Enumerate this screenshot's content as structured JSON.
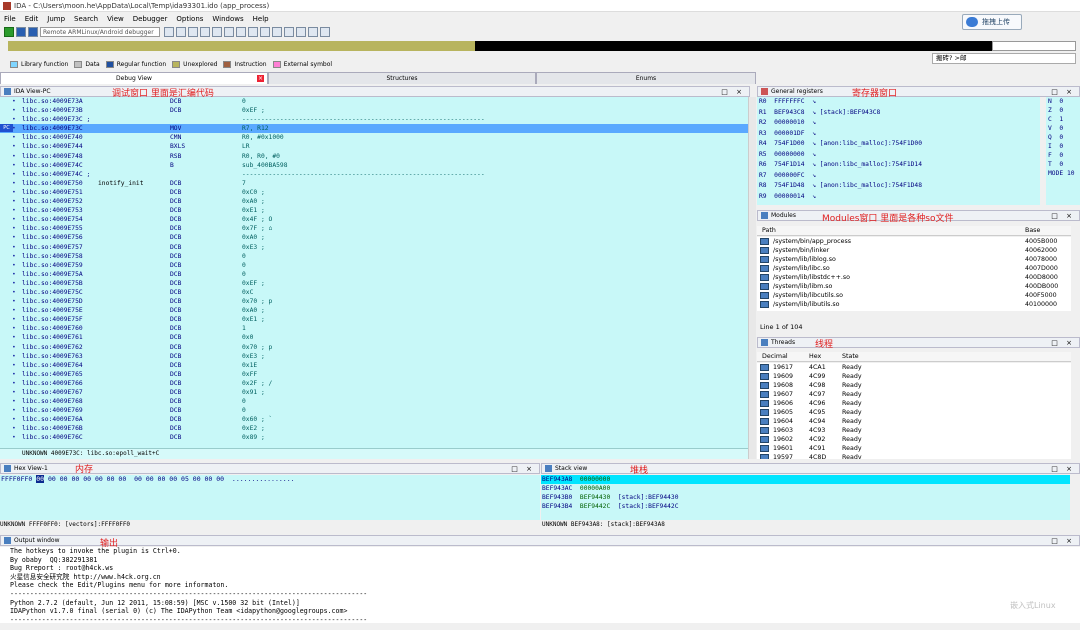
{
  "window": {
    "title": "IDA - C:\\Users\\moon.he\\AppData\\Local\\Temp\\ida93301.ido (app_process)"
  },
  "upload_button": "拖拽上传",
  "menu": [
    "File",
    "Edit",
    "Jump",
    "Search",
    "View",
    "Debugger",
    "Options",
    "Windows",
    "Help"
  ],
  "debugger_select": "Remote ARMLinux/Android debugger",
  "legend": [
    {
      "label": "Library function",
      "color": "#7fd5ff"
    },
    {
      "label": "Data",
      "color": "#c0c0c0"
    },
    {
      "label": "Regular function",
      "color": "#2050a0"
    },
    {
      "label": "Unexplored",
      "color": "#b8b45e"
    },
    {
      "label": "Instruction",
      "color": "#a06040"
    },
    {
      "label": "External symbol",
      "color": "#ff7fd5"
    }
  ],
  "tip": "搬砖? >邮",
  "tabs": {
    "debug": "Debug View",
    "structures": "Structures",
    "enums": "Enums"
  },
  "ida_view": {
    "title": "IDA View-PC",
    "annotation": "调试窗口 里面是汇编代码"
  },
  "pc_marker": "PC",
  "disasm": [
    {
      "addr": "libc.so:4009E73A",
      "lbl": "",
      "mn": "DCB",
      "op": "0",
      "sel": false
    },
    {
      "addr": "libc.so:4009E73B",
      "lbl": "",
      "mn": "DCB",
      "op": "0xEF ;",
      "sel": false
    },
    {
      "addr": "libc.so:4009E73C ;",
      "lbl": "",
      "mn": "",
      "op": "----------------------------------------------------------------",
      "sel": false
    },
    {
      "addr": "libc.so:4009E73C",
      "lbl": "",
      "mn": "MOV",
      "op": "R7, R12",
      "sel": true
    },
    {
      "addr": "libc.so:4009E740",
      "lbl": "",
      "mn": "CMN",
      "op": "R0, #0x1000",
      "sel": false
    },
    {
      "addr": "libc.so:4009E744",
      "lbl": "",
      "mn": "BXLS",
      "op": "LR",
      "sel": false
    },
    {
      "addr": "libc.so:4009E748",
      "lbl": "",
      "mn": "RSB",
      "op": "R0, R0, #0",
      "sel": false
    },
    {
      "addr": "libc.so:4009E74C",
      "lbl": "",
      "mn": "B",
      "op": "sub_400BA598",
      "sel": false
    },
    {
      "addr": "libc.so:4009E74C ;",
      "lbl": "",
      "mn": "",
      "op": "----------------------------------------------------------------",
      "sel": false
    },
    {
      "addr": "libc.so:4009E750",
      "lbl": "inotify_init",
      "mn": "DCB",
      "op": "7",
      "sel": false
    },
    {
      "addr": "libc.so:4009E751",
      "lbl": "",
      "mn": "DCB",
      "op": "0xC0 ;",
      "sel": false
    },
    {
      "addr": "libc.so:4009E752",
      "lbl": "",
      "mn": "DCB",
      "op": "0xA0 ;",
      "sel": false
    },
    {
      "addr": "libc.so:4009E753",
      "lbl": "",
      "mn": "DCB",
      "op": "0xE1 ;",
      "sel": false
    },
    {
      "addr": "libc.so:4009E754",
      "lbl": "",
      "mn": "DCB",
      "op": "0x4F ; O",
      "sel": false
    },
    {
      "addr": "libc.so:4009E755",
      "lbl": "",
      "mn": "DCB",
      "op": "0x7F ; ⌂",
      "sel": false
    },
    {
      "addr": "libc.so:4009E756",
      "lbl": "",
      "mn": "DCB",
      "op": "0xA0 ;",
      "sel": false
    },
    {
      "addr": "libc.so:4009E757",
      "lbl": "",
      "mn": "DCB",
      "op": "0xE3 ;",
      "sel": false
    },
    {
      "addr": "libc.so:4009E758",
      "lbl": "",
      "mn": "DCB",
      "op": "0",
      "sel": false
    },
    {
      "addr": "libc.so:4009E759",
      "lbl": "",
      "mn": "DCB",
      "op": "0",
      "sel": false
    },
    {
      "addr": "libc.so:4009E75A",
      "lbl": "",
      "mn": "DCB",
      "op": "0",
      "sel": false
    },
    {
      "addr": "libc.so:4009E75B",
      "lbl": "",
      "mn": "DCB",
      "op": "0xEF ;",
      "sel": false
    },
    {
      "addr": "libc.so:4009E75C",
      "lbl": "",
      "mn": "DCB",
      "op": "0xC",
      "sel": false
    },
    {
      "addr": "libc.so:4009E75D",
      "lbl": "",
      "mn": "DCB",
      "op": "0x70 ; p",
      "sel": false
    },
    {
      "addr": "libc.so:4009E75E",
      "lbl": "",
      "mn": "DCB",
      "op": "0xA0 ;",
      "sel": false
    },
    {
      "addr": "libc.so:4009E75F",
      "lbl": "",
      "mn": "DCB",
      "op": "0xE1 ;",
      "sel": false
    },
    {
      "addr": "libc.so:4009E760",
      "lbl": "",
      "mn": "DCB",
      "op": "1",
      "sel": false
    },
    {
      "addr": "libc.so:4009E761",
      "lbl": "",
      "mn": "DCB",
      "op": "0x0",
      "sel": false
    },
    {
      "addr": "libc.so:4009E762",
      "lbl": "",
      "mn": "DCB",
      "op": "0x70 ; p",
      "sel": false
    },
    {
      "addr": "libc.so:4009E763",
      "lbl": "",
      "mn": "DCB",
      "op": "0xE3 ;",
      "sel": false
    },
    {
      "addr": "libc.so:4009E764",
      "lbl": "",
      "mn": "DCB",
      "op": "0x1E",
      "sel": false
    },
    {
      "addr": "libc.so:4009E765",
      "lbl": "",
      "mn": "DCB",
      "op": "0xFF",
      "sel": false
    },
    {
      "addr": "libc.so:4009E766",
      "lbl": "",
      "mn": "DCB",
      "op": "0x2F ; /",
      "sel": false
    },
    {
      "addr": "libc.so:4009E767",
      "lbl": "",
      "mn": "DCB",
      "op": "0x91 ;",
      "sel": false
    },
    {
      "addr": "libc.so:4009E768",
      "lbl": "",
      "mn": "DCB",
      "op": "0",
      "sel": false
    },
    {
      "addr": "libc.so:4009E769",
      "lbl": "",
      "mn": "DCB",
      "op": "0",
      "sel": false
    },
    {
      "addr": "libc.so:4009E76A",
      "lbl": "",
      "mn": "DCB",
      "op": "0x60 ; `",
      "sel": false
    },
    {
      "addr": "libc.so:4009E76B",
      "lbl": "",
      "mn": "DCB",
      "op": "0xE2 ;",
      "sel": false
    },
    {
      "addr": "libc.so:4009E76C",
      "lbl": "",
      "mn": "DCB",
      "op": "0x89 ;",
      "sel": false
    }
  ],
  "disasm_status": "UNKNOWN 4009E73C: libc.so:epoll_wait+C",
  "registers": {
    "title": "General registers",
    "annotation": "寄存器窗口",
    "rows": [
      "R0  FFFFFFFC  ↘",
      "R1  BEF943C8  ↘ [stack]:BEF943C8",
      "R2  00000010  ↘",
      "R3  000001DF  ↘",
      "R4  754F1D00  ↘ [anon:libc_malloc]:754F1D00",
      "R5  00000000  ↘",
      "R6  754F1D14  ↘ [anon:libc_malloc]:754F1D14",
      "R7  000000FC  ↘",
      "R8  754F1D48  ↘ [anon:libc_malloc]:754F1D48",
      "R9  00000014  ↘"
    ],
    "flags": [
      "N  0",
      "Z  0",
      "C  1",
      "V  0",
      "Q  0",
      "I  0",
      "F  0",
      "T  0",
      "MODE 10"
    ]
  },
  "modules": {
    "title": "Modules",
    "annotation": "Modules窗口 里面是各种so文件",
    "col_path": "Path",
    "col_base": "Base",
    "rows": [
      [
        "/system/bin/app_process",
        "4005B000"
      ],
      [
        "/system/bin/linker",
        "40062000"
      ],
      [
        "/system/lib/liblog.so",
        "40078000"
      ],
      [
        "/system/lib/libc.so",
        "4007D000"
      ],
      [
        "/system/lib/libstdc++.so",
        "400D8000"
      ],
      [
        "/system/lib/libm.so",
        "400DB000"
      ],
      [
        "/system/lib/libcutils.so",
        "400F5000"
      ],
      [
        "/system/lib/libutils.so",
        "40100000"
      ]
    ],
    "status": "Line 1 of 104"
  },
  "threads": {
    "title": "Threads",
    "annotation": "线程",
    "col_dec": "Decimal",
    "col_hex": "Hex",
    "col_state": "State",
    "rows": [
      [
        "19617",
        "4CA1",
        "Ready"
      ],
      [
        "19609",
        "4C99",
        "Ready"
      ],
      [
        "19608",
        "4C98",
        "Ready"
      ],
      [
        "19607",
        "4C97",
        "Ready"
      ],
      [
        "19606",
        "4C96",
        "Ready"
      ],
      [
        "19605",
        "4C95",
        "Ready"
      ],
      [
        "19604",
        "4C94",
        "Ready"
      ],
      [
        "19603",
        "4C93",
        "Ready"
      ],
      [
        "19602",
        "4C92",
        "Ready"
      ],
      [
        "19601",
        "4C91",
        "Ready"
      ],
      [
        "19597",
        "4C8D",
        "Ready"
      ]
    ]
  },
  "hex": {
    "title": "Hex View-1",
    "annotation": "内存",
    "addr": "FFFF0FF0",
    "first": "00",
    "bytes": "00 00 00 00 00 00 00  00 00 00 00 05 00 00 00",
    "ascii": "................",
    "status": "UNKNOWN FFFF0FF0: [vectors]:FFFF0FF0"
  },
  "stack": {
    "title": "Stack view",
    "annotation": "堆栈",
    "rows": [
      {
        "a": "BEF943A8",
        "v": "00000000",
        "c": "",
        "sel": true
      },
      {
        "a": "BEF943AC",
        "v": "00000A00",
        "c": "",
        "sel": false
      },
      {
        "a": "BEF943B0",
        "v": "BEF94430",
        "c": "[stack]:BEF94430",
        "sel": false
      },
      {
        "a": "BEF943B4",
        "v": "BEF9442C",
        "c": "[stack]:BEF9442C",
        "sel": false
      }
    ],
    "status": "UNKNOWN BEF943A8: [stack]:BEF943A8"
  },
  "output": {
    "title": "Output window",
    "annotation": "输出",
    "lines": [
      "The hotkeys to invoke the plugin is Ctrl+0.",
      "By obaby  QQ:382291381",
      "Bug Rreport : root@h4ck.ws",
      "火星信息安全研究院 http://www.h4ck.org.cn",
      "Please check the Edit/Plugins menu for more informaton.",
      "------------------------------------------------------------------------------------------",
      "Python 2.7.2 (default, Jun 12 2011, 15:08:59) [MSC v.1500 32 bit (Intel)]",
      "IDAPython v1.7.0 final (serial 0) (c) The IDAPython Team <idapython@googlegroups.com>",
      "------------------------------------------------------------------------------------------"
    ]
  },
  "watermark": "嵌入式Linux"
}
